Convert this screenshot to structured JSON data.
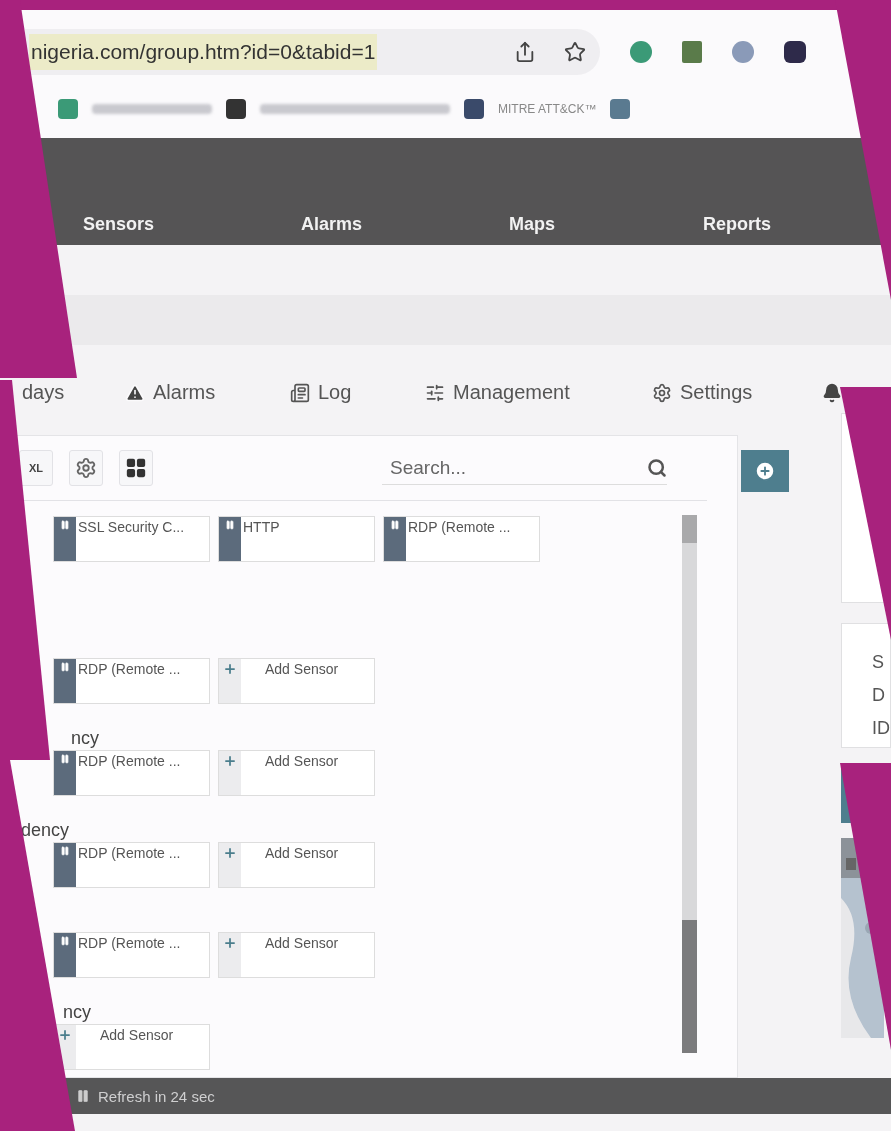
{
  "browser": {
    "url": "nigeria.com/group.htm?id=0&tabid=1",
    "url_selected": true,
    "bookmarks": [
      {
        "label": "MITRE ATT&CK™"
      }
    ]
  },
  "nav": {
    "items": [
      {
        "label": "Sensors"
      },
      {
        "label": "Alarms"
      },
      {
        "label": "Maps"
      },
      {
        "label": "Reports"
      }
    ]
  },
  "tabs": [
    {
      "label": "days"
    },
    {
      "label": "Alarms"
    },
    {
      "label": "Log"
    },
    {
      "label": "Management"
    },
    {
      "label": "Settings"
    }
  ],
  "toolbar": {
    "button": "XL",
    "search": {
      "placeholder": "Search..."
    }
  },
  "groups": [
    {
      "tiles": [
        {
          "kind": "sensor",
          "label": "SSL Security C..."
        },
        {
          "kind": "sensor",
          "label": "HTTP"
        },
        {
          "kind": "sensor",
          "label": "RDP (Remote ..."
        }
      ]
    },
    {
      "tiles": [
        {
          "kind": "sensor",
          "label": "RDP (Remote ..."
        },
        {
          "kind": "add",
          "label": "Add Sensor"
        }
      ]
    },
    {
      "label": "ncy",
      "tiles": [
        {
          "kind": "sensor",
          "label": "RDP (Remote ..."
        },
        {
          "kind": "add",
          "label": "Add Sensor"
        }
      ]
    },
    {
      "label": "dency",
      "tiles": [
        {
          "kind": "sensor",
          "label": "RDP (Remote ..."
        },
        {
          "kind": "add",
          "label": "Add Sensor"
        }
      ]
    },
    {
      "tiles": [
        {
          "kind": "sensor",
          "label": "RDP (Remote ..."
        },
        {
          "kind": "add",
          "label": "Add Sensor"
        }
      ]
    },
    {
      "label": "ncy",
      "tiles": [
        {
          "kind": "add",
          "label": "Add Sensor"
        }
      ]
    }
  ],
  "side_letters": [
    {
      "label": "S"
    },
    {
      "label": "D"
    },
    {
      "label": "ID"
    }
  ],
  "status_bar": {
    "text": "Refresh in 24 sec"
  }
}
